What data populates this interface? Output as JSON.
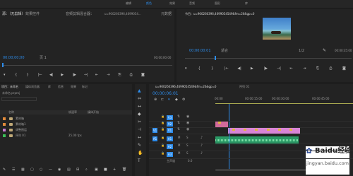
{
  "workspace_tabs": [
    "编辑",
    "颜色",
    "效果",
    "音频",
    "图形",
    "库"
  ],
  "source_panel": {
    "tabs": [
      "源：（无剪辑）",
      "效果控件",
      "音频剪辑混合器：",
      "元数据"
    ],
    "seq_path": "u=900260396,4699054...",
    "timecode": "00;00;00;00",
    "page": "页 1",
    "right_timecode": "00;00;00;00"
  },
  "program_panel": {
    "tab": "节目：u=900260396,4699054549&fm=26&gp=0",
    "timecode": "00:00:00:01",
    "fit": "适合",
    "ratio": "1/2",
    "right_timecode": "00:00:35:00"
  },
  "project_panel": {
    "tabs": [
      "项目：未命名",
      "媒体浏览器",
      "库",
      "信息",
      "效果",
      "标记"
    ],
    "project_name": "未命名.prproj",
    "col_name": "名称",
    "col_fps": "帧速率",
    "col_start": "媒体开始",
    "items": [
      {
        "name": "素材箱",
        "fps": "",
        "color": "#e08a3a"
      },
      {
        "name": "素材箱1",
        "fps": "",
        "color": "#e08a3a"
      },
      {
        "name": "调整图层",
        "fps": "",
        "color": "#c77bd1"
      },
      {
        "name": "序列 01",
        "fps": "25.00 fps",
        "color": "#3bbf57"
      }
    ]
  },
  "timeline": {
    "tab": "u=900260396,4699054549&fm=26&gp=0",
    "seq_tab": "序列 01",
    "timecode": "00:00:06:01",
    "ruler": [
      "00:00",
      "00:00:15:00",
      "00:00:30:00",
      "00:00:45:00"
    ],
    "video_tracks": [
      "V3",
      "V2",
      "V1"
    ],
    "audio_tracks": [
      "A1",
      "A2",
      "A3"
    ],
    "v1_label": "V1",
    "a1_label": "A1",
    "master_label": "主声道",
    "master_value": "0.0"
  },
  "watermark": {
    "line1": "Baidu经验",
    "line2": "jingyan.baidu.com"
  },
  "colors": {
    "accent": "#2d8ceb",
    "clip_video": "#d985d6",
    "clip_audio": "#2a9a66",
    "scrollbar": "#3d3d3d"
  }
}
